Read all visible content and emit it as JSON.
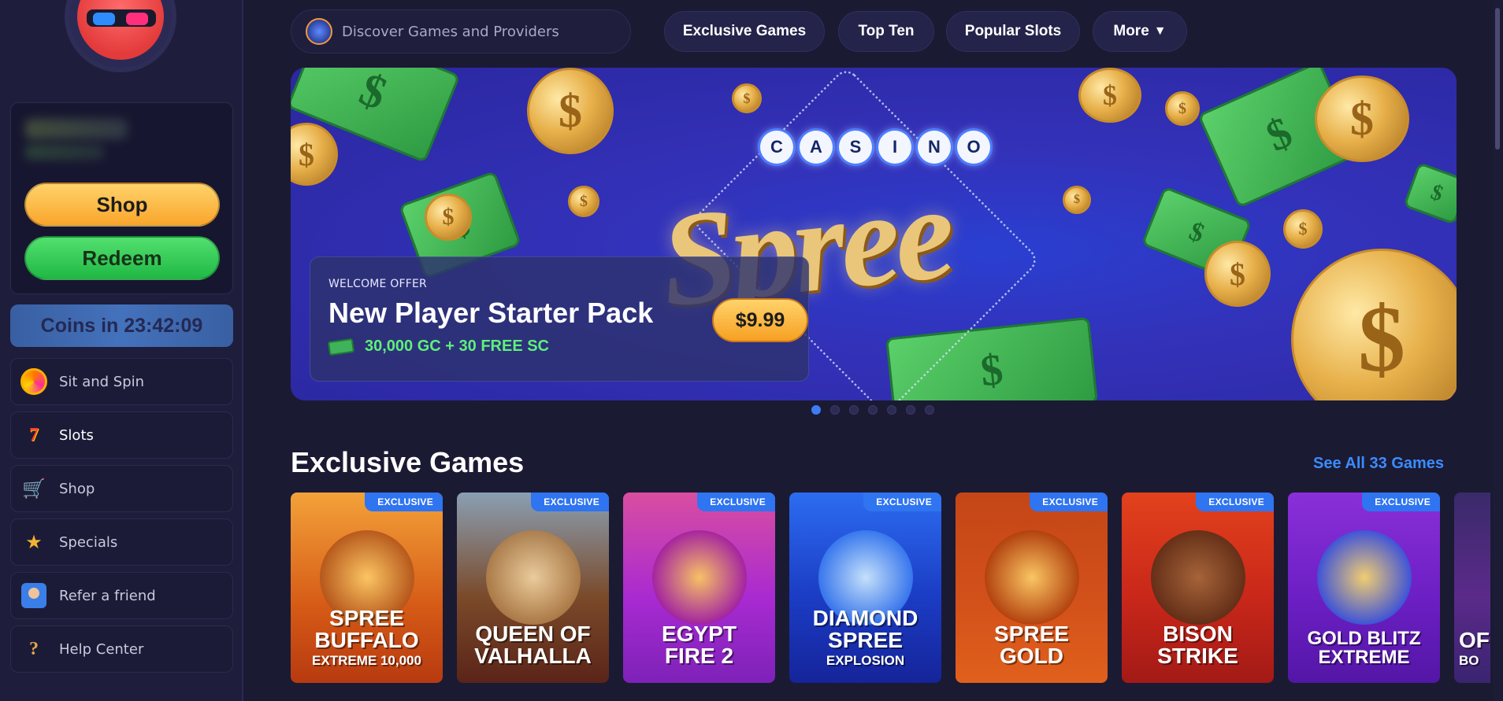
{
  "sidebar": {
    "shop_label": "Shop",
    "redeem_label": "Redeem",
    "coins_timer": "Coins in 23:42:09",
    "items": [
      {
        "label": "Sit and Spin",
        "icon": "sit-and-spin-icon"
      },
      {
        "label": "Slots",
        "icon": "slots-seven-icon"
      },
      {
        "label": "Shop",
        "icon": "shopping-cart-icon"
      },
      {
        "label": "Specials",
        "icon": "star-medal-icon"
      },
      {
        "label": "Refer a friend",
        "icon": "refer-friend-icon"
      },
      {
        "label": "Help Center",
        "icon": "help-question-icon"
      }
    ]
  },
  "topnav": {
    "search_placeholder": "Discover Games and Providers",
    "tabs": [
      "Exclusive Games",
      "Top Ten",
      "Popular Slots",
      "More"
    ]
  },
  "hero": {
    "logo_top": "CASINO",
    "logo_main": "Spree",
    "offer_kicker": "WELCOME OFFER",
    "offer_title": "New Player Starter Pack",
    "offer_sub": "30,000 GC + 30 FREE SC",
    "price": "$9.99",
    "slides_total": 7,
    "active_slide": 0
  },
  "exclusive": {
    "title": "Exclusive Games",
    "see_all": "See All 33 Games",
    "badge": "EXCLUSIVE",
    "games": [
      {
        "line1": "SPREE",
        "line2": "BUFFALO",
        "line3": "EXTREME 10,000"
      },
      {
        "line1": "QUEEN OF",
        "line2": "VALHALLA",
        "line3": ""
      },
      {
        "line1": "EGYPT",
        "line2": "FIRE 2",
        "line3": ""
      },
      {
        "line1": "DIAMOND",
        "line2": "SPREE",
        "line3": "EXPLOSION"
      },
      {
        "line1": "SPREE",
        "line2": "GOLD",
        "line3": ""
      },
      {
        "line1": "BISON",
        "line2": "STRIKE",
        "line3": ""
      },
      {
        "line1": "GOLD BLITZ",
        "line2": "EXTREME",
        "line3": ""
      },
      {
        "line1": "OF",
        "line2": "BO",
        "line3": ""
      }
    ]
  },
  "colors": {
    "background": "#1b1a33",
    "accent_blue": "#3b8cff",
    "shop_gold": "#f9a52b",
    "redeem_green": "#20b845",
    "offer_green": "#5ef07a"
  }
}
